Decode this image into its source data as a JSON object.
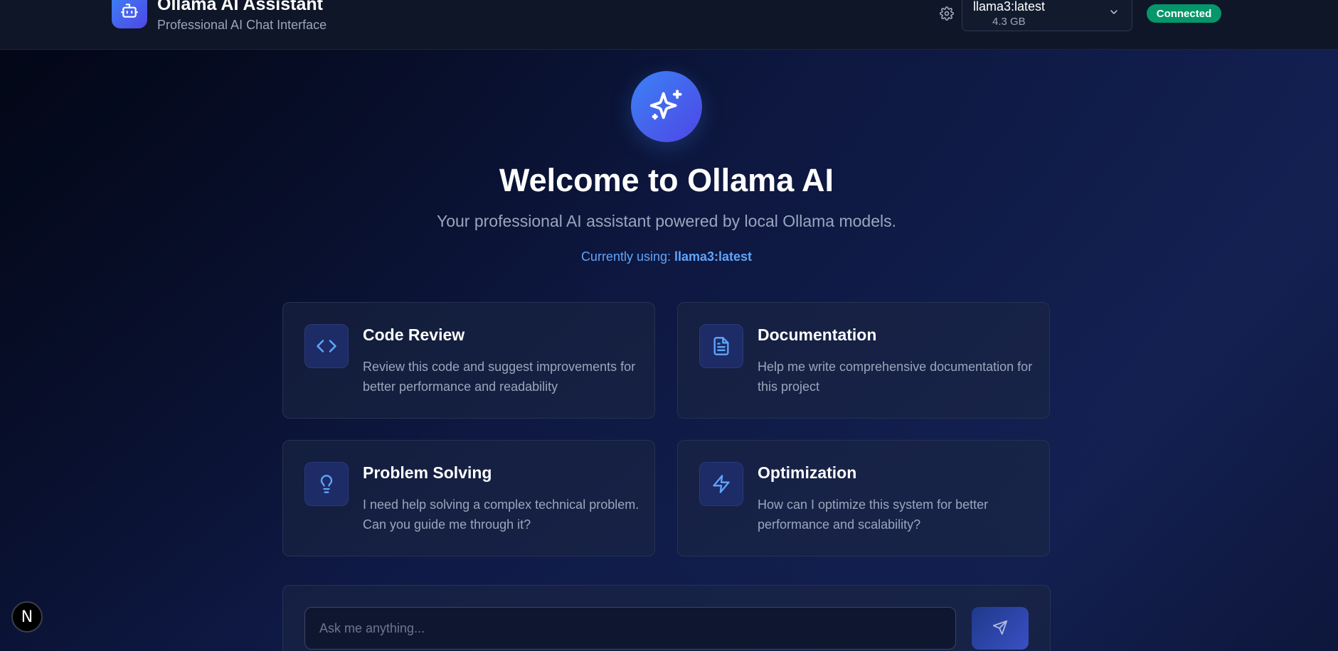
{
  "header": {
    "title": "Ollama AI Assistant",
    "subtitle": "Professional AI Chat Interface",
    "model": {
      "name": "llama3:latest",
      "size": "4.3 GB"
    },
    "status": "Connected",
    "icons": {
      "logo": "robot-icon",
      "settings": "gear-icon",
      "dropdown": "chevron-down-icon"
    }
  },
  "hero": {
    "icon": "sparkles-icon",
    "title": "Welcome to Ollama AI",
    "subtitle": "Your professional AI assistant powered by local Ollama models.",
    "current_prefix": "Currently using: ",
    "current_model": "llama3:latest"
  },
  "cards": [
    {
      "icon": "code-icon",
      "title": "Code Review",
      "desc": "Review this code and suggest improvements for better performance and readability"
    },
    {
      "icon": "document-icon",
      "title": "Documentation",
      "desc": "Help me write comprehensive documentation for this project"
    },
    {
      "icon": "lightbulb-icon",
      "title": "Problem Solving",
      "desc": "I need help solving a complex technical problem. Can you guide me through it?"
    },
    {
      "icon": "lightning-icon",
      "title": "Optimization",
      "desc": "How can I optimize this system for better performance and scalability?"
    }
  ],
  "composer": {
    "placeholder": "Ask me anything...",
    "send_icon": "send-icon"
  },
  "dev_badge": {
    "label": "N",
    "icon": "nextjs-icon"
  },
  "colors": {
    "accent": "#3b82f6",
    "accent_dark": "#4f46e5",
    "status": "#059669",
    "link": "#60a5fa"
  }
}
